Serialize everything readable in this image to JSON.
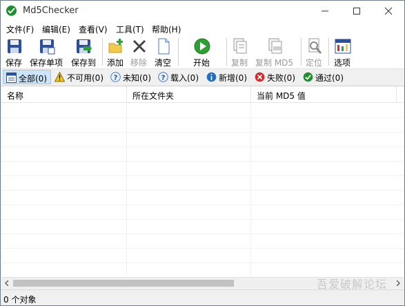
{
  "window": {
    "title": "Md5Checker"
  },
  "menu": [
    "文件(F)",
    "编辑(E)",
    "查看(V)",
    "工具(T)",
    "帮助(H)"
  ],
  "toolbar": {
    "save": "保存",
    "save_item": "保存单项",
    "save_to": "保存到",
    "add": "添加",
    "remove": "移除",
    "clear": "清空",
    "start": "开始",
    "copy": "复制",
    "copy_md5": "复制 MD5",
    "locate": "定位",
    "options": "选项"
  },
  "filters": [
    {
      "label": "全部(0)",
      "icon": "list-icon",
      "active": true
    },
    {
      "label": "不可用(0)",
      "icon": "warning-icon"
    },
    {
      "label": "未知(0)",
      "icon": "question-icon"
    },
    {
      "label": "载入(0)",
      "icon": "question-icon"
    },
    {
      "label": "新增(0)",
      "icon": "info-icon"
    },
    {
      "label": "失败(0)",
      "icon": "error-icon"
    },
    {
      "label": "通过(0)",
      "icon": "check-icon"
    }
  ],
  "columns": [
    "名称",
    "所在文件夹",
    "当前 MD5 值"
  ],
  "status": {
    "text": "0 个对象"
  },
  "watermark": {
    "text": "吾爱破解论坛"
  },
  "colors": {
    "accent_green": "#1e8f2e",
    "selected_bg": "#cce4f7",
    "error_red": "#d9252b",
    "info_blue": "#1f6fc5"
  }
}
